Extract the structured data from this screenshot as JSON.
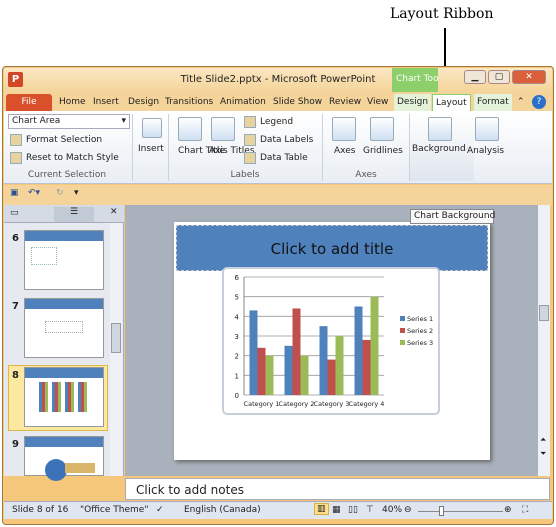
{
  "annotation": {
    "label": "Layout Ribbon"
  },
  "window": {
    "title": "Title Slide2.pptx - Microsoft PowerPoint",
    "app_icon": "P",
    "context_tab": "Chart Tools",
    "controls": [
      "minimize-icon",
      "restore-icon",
      "close-icon"
    ]
  },
  "tabs": [
    "File",
    "Home",
    "Insert",
    "Design",
    "Transitions",
    "Animation",
    "Slide Show",
    "Review",
    "View",
    "Design",
    "Layout",
    "Format"
  ],
  "ribbon": {
    "current_selection": {
      "combo_value": "Chart Area",
      "format_selection": "Format Selection",
      "reset": "Reset to Match Style",
      "label": "Current Selection"
    },
    "insert": "Insert",
    "labels": {
      "chart_title": "Chart Title",
      "axis_titles": "Axis Titles",
      "legend": "Legend",
      "data_labels": "Data Labels",
      "data_table": "Data Table",
      "label": "Labels"
    },
    "axes": {
      "axes": "Axes",
      "gridlines": "Gridlines",
      "label": "Axes"
    },
    "background": "Background",
    "analysis": "Analysis"
  },
  "tooltip": "Chart Background",
  "slides": [
    {
      "num": "6"
    },
    {
      "num": "7"
    },
    {
      "num": "8",
      "selected": true
    },
    {
      "num": "9"
    }
  ],
  "slide": {
    "title": "Click to add title"
  },
  "chart_data": {
    "type": "bar",
    "categories": [
      "Category 1",
      "Category 2",
      "Category 3",
      "Category 4"
    ],
    "series": [
      {
        "name": "Series 1",
        "color": "#4f81bd",
        "values": [
          4.3,
          2.5,
          3.5,
          4.5
        ]
      },
      {
        "name": "Series 2",
        "color": "#c0504d",
        "values": [
          2.4,
          4.4,
          1.8,
          2.8
        ]
      },
      {
        "name": "Series 3",
        "color": "#9bbb59",
        "values": [
          2,
          2,
          3,
          5
        ]
      }
    ],
    "ylim": [
      0,
      6
    ],
    "yticks": [
      "0",
      "1",
      "2",
      "3",
      "4",
      "5",
      "6"
    ],
    "grid": true,
    "legend": "right"
  },
  "notes": "Click to add notes",
  "status": {
    "slide": "Slide 8 of 16",
    "theme": "\"Office Theme\"",
    "language": "English (Canada)",
    "zoom": "40%",
    "zoom_level": 0.4
  }
}
